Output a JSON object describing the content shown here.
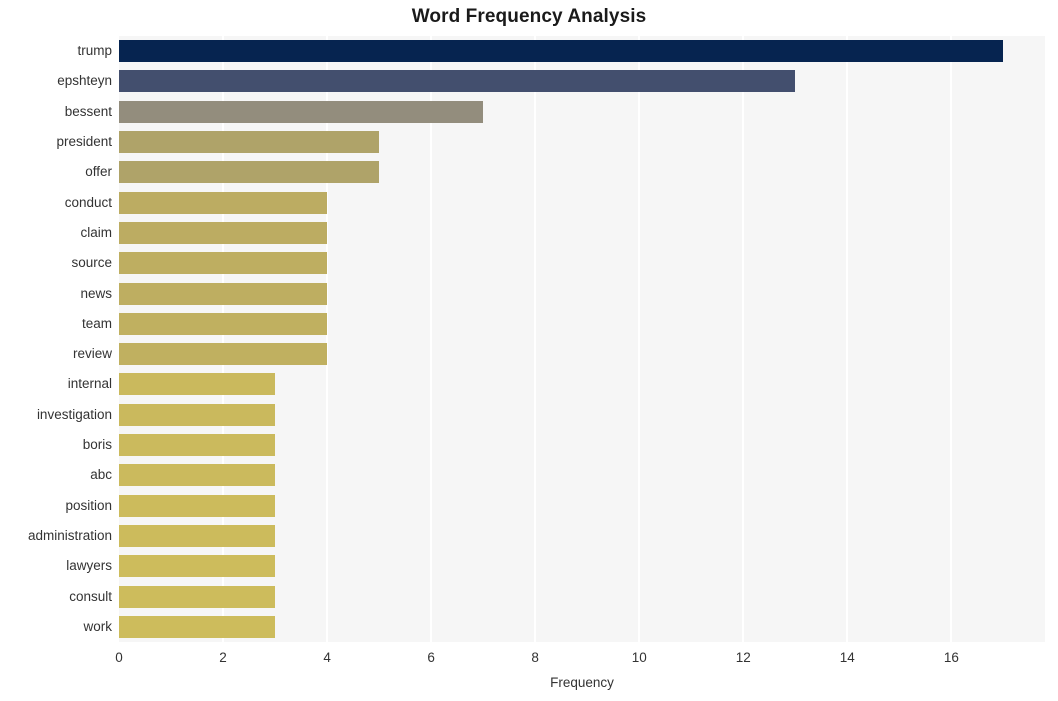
{
  "chart_data": {
    "type": "bar",
    "orientation": "horizontal",
    "title": "Word Frequency Analysis",
    "xlabel": "Frequency",
    "ylabel": "",
    "xlim": [
      0,
      17.8
    ],
    "ylim": null,
    "grid": true,
    "legend": null,
    "xticks": [
      0,
      2,
      4,
      6,
      8,
      10,
      12,
      14,
      16
    ],
    "xtick_labels": [
      "0",
      "2",
      "4",
      "6",
      "8",
      "10",
      "12",
      "14",
      "16"
    ],
    "categories": [
      "trump",
      "epshteyn",
      "bessent",
      "president",
      "offer",
      "conduct",
      "claim",
      "source",
      "news",
      "team",
      "review",
      "internal",
      "investigation",
      "boris",
      "abc",
      "position",
      "administration",
      "lawyers",
      "consult",
      "work"
    ],
    "values": [
      17,
      13,
      7,
      5,
      5,
      4,
      4,
      4,
      4,
      4,
      4,
      3,
      3,
      3,
      3,
      3,
      3,
      3,
      3,
      3
    ],
    "bar_colors": [
      "#062450",
      "#434F6E",
      "#938D7D",
      "#AFA369",
      "#AFA369",
      "#BCAC62",
      "#BCAC62",
      "#BEAE61",
      "#BEAE61",
      "#C0B060",
      "#C0B060",
      "#CAB95D",
      "#CAB95D",
      "#CBBA5D",
      "#CBBA5D",
      "#CCBB5C",
      "#CCBB5C",
      "#CDBC5C",
      "#CDBC5C",
      "#CDBC5C"
    ],
    "plot_background": "#F6F6F6",
    "gridline_color": "#FFFFFF",
    "figure_background": "#FFFFFF",
    "text_color": "#333333",
    "title_color": "#1A1A1A"
  }
}
